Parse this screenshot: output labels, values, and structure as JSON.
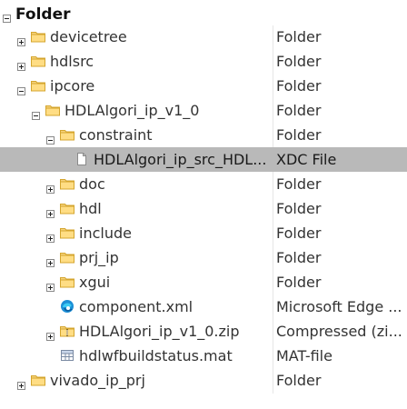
{
  "header": {
    "title": "Folder"
  },
  "rows": [
    {
      "name": "devicetree",
      "type": "Folder",
      "icon": "folder-icon",
      "expander": "plus"
    },
    {
      "name": "hdlsrc",
      "type": "Folder",
      "icon": "folder-icon",
      "expander": "plus"
    },
    {
      "name": "ipcore",
      "type": "Folder",
      "icon": "folder-icon",
      "expander": "minus"
    },
    {
      "name": "HDLAlgori_ip_v1_0",
      "type": "Folder",
      "icon": "folder-icon",
      "expander": "minus"
    },
    {
      "name": "constraint",
      "type": "Folder",
      "icon": "folder-icon",
      "expander": "minus"
    },
    {
      "name": "HDLAlgori_ip_src_HDL...",
      "type": "XDC File",
      "icon": "file-icon",
      "expander": "none",
      "selected": true
    },
    {
      "name": "doc",
      "type": "Folder",
      "icon": "folder-icon",
      "expander": "plus"
    },
    {
      "name": "hdl",
      "type": "Folder",
      "icon": "folder-icon",
      "expander": "plus"
    },
    {
      "name": "include",
      "type": "Folder",
      "icon": "folder-icon",
      "expander": "plus"
    },
    {
      "name": "prj_ip",
      "type": "Folder",
      "icon": "folder-icon",
      "expander": "plus"
    },
    {
      "name": "xgui",
      "type": "Folder",
      "icon": "folder-icon",
      "expander": "plus"
    },
    {
      "name": "component.xml",
      "type": "Microsoft Edge ...",
      "icon": "edge-icon",
      "expander": "none"
    },
    {
      "name": "HDLAlgori_ip_v1_0.zip",
      "type": "Compressed (zi...",
      "icon": "zip-folder-icon",
      "expander": "plus"
    },
    {
      "name": "hdlwfbuildstatus.mat",
      "type": "MAT-file",
      "icon": "mat-file-icon",
      "expander": "none"
    },
    {
      "name": "vivado_ip_prj",
      "type": "Folder",
      "icon": "folder-icon",
      "expander": "plus"
    }
  ]
}
